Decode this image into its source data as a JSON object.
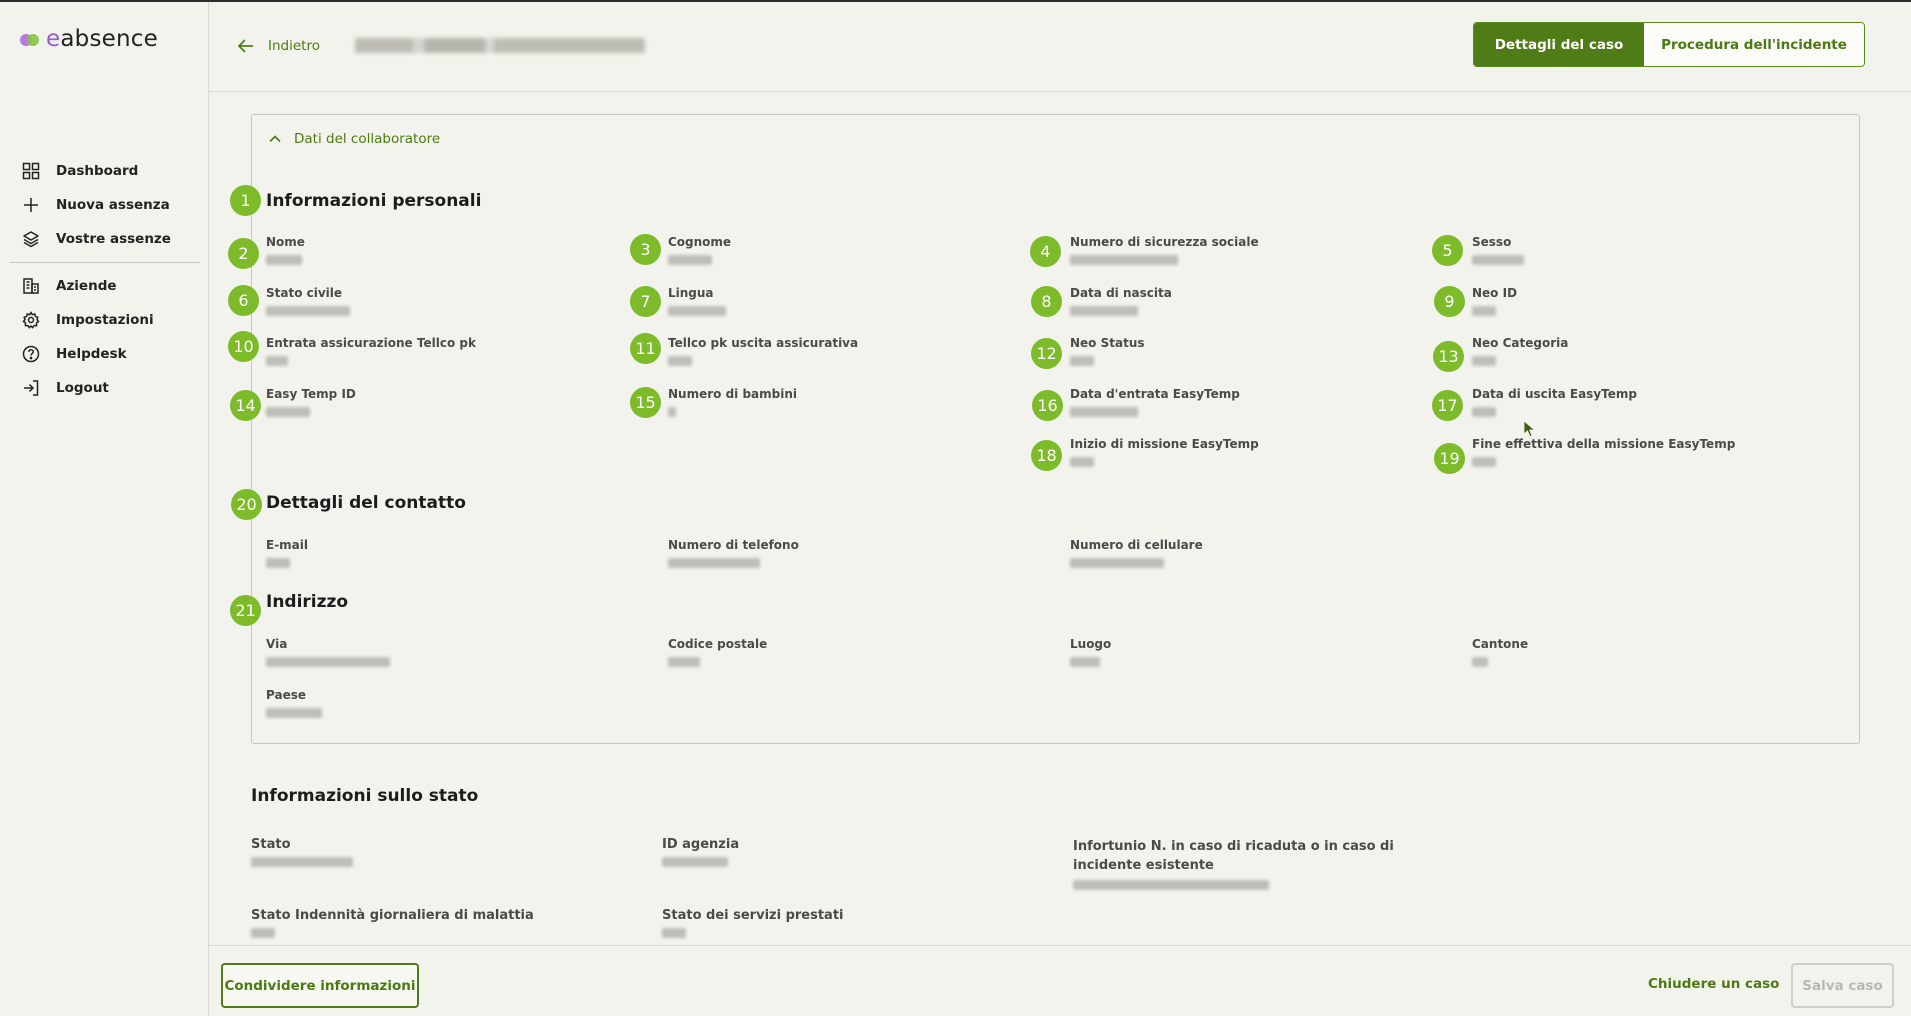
{
  "brand": {
    "prefix": "e",
    "rest": "absence"
  },
  "nav": [
    {
      "label": "Dashboard",
      "icon": "grid-icon"
    },
    {
      "label": "Nuova assenza",
      "icon": "plus-icon"
    },
    {
      "label": "Vostre assenze",
      "icon": "layers-icon"
    },
    {
      "label": "Aziende",
      "icon": "building-icon"
    },
    {
      "label": "Impostazioni",
      "icon": "gear-icon"
    },
    {
      "label": "Helpdesk",
      "icon": "help-icon"
    },
    {
      "label": "Logout",
      "icon": "logout-icon"
    }
  ],
  "header": {
    "back_label": "Indietro",
    "tabs": [
      "Dettagli del caso",
      "Procedura dell'incidente"
    ]
  },
  "panel": {
    "toggle_label": "Dati del collaboratore",
    "personal": {
      "title": "Informazioni personali",
      "fields": [
        "Nome",
        "Cognome",
        "Numero di sicurezza sociale",
        "Sesso",
        "Stato civile",
        "Lingua",
        "Data di nascita",
        "Neo ID",
        "Entrata assicurazione Tellco pk",
        "Tellco pk uscita assicurativa",
        "Neo Status",
        "Neo Categoria",
        "Easy Temp ID",
        "Numero di bambini",
        "Data d'entrata EasyTemp",
        "Data di uscita EasyTemp",
        "Inizio di missione EasyTemp",
        "Fine effettiva della missione EasyTemp"
      ]
    },
    "contact": {
      "title": "Dettagli del contatto",
      "fields": [
        "E-mail",
        "Numero di telefono",
        "Numero di cellulare"
      ]
    },
    "address": {
      "title": "Indirizzo",
      "fields": [
        "Via",
        "Codice postale",
        "Luogo",
        "Cantone",
        "Paese"
      ]
    }
  },
  "status": {
    "title": "Informazioni sullo stato",
    "fields": [
      "Stato",
      "ID agenzia",
      "Infortunio N. in caso di ricaduta o in caso di incidente esistente",
      "Stato Indennità giornaliera di malattia",
      "Stato dei servizi prestati"
    ]
  },
  "badges": [
    "1",
    "2",
    "3",
    "4",
    "5",
    "6",
    "7",
    "8",
    "9",
    "10",
    "11",
    "12",
    "13",
    "14",
    "15",
    "16",
    "17",
    "18",
    "19",
    "20",
    "21"
  ],
  "footer": {
    "share_label": "Condividere informazioni",
    "close_label": "Chiudere un caso",
    "save_label": "Salva caso"
  },
  "colors": {
    "accent": "#4f7c16",
    "badge": "#7dbb2b",
    "brand_purple": "#9b59d6"
  }
}
